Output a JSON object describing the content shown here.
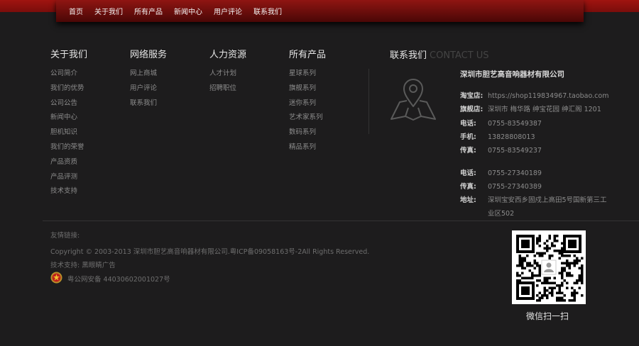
{
  "nav": [
    "首页",
    "关于我们",
    "所有产品",
    "新闻中心",
    "用户评论",
    "联系我们"
  ],
  "columns": [
    {
      "title": "关于我们",
      "items": [
        "公司简介",
        "我们的优势",
        "公司公告",
        "新闻中心",
        "胆机知识",
        "我们的荣誉",
        "产品资质",
        "产品评测",
        "技术支持"
      ]
    },
    {
      "title": "网络服务",
      "items": [
        "网上商城",
        "用户评论",
        "联系我们"
      ]
    },
    {
      "title": "人力资源",
      "items": [
        "人才计划",
        "招聘职位"
      ]
    },
    {
      "title": "所有产品",
      "items": [
        "星球系列",
        "旗舰系列",
        "迷你系列",
        "艺术家系列",
        "数码系列",
        "精品系列"
      ]
    }
  ],
  "contact": {
    "title": "联系我们",
    "title_en": "CONTACT US",
    "company": "深圳市胆艺高音响器材有限公司",
    "rows": [
      {
        "k": "淘宝店:",
        "v": "https://shop119834967.taobao.com"
      },
      {
        "k": "旗舰店:",
        "v": "深圳市 梅华路 绅宝花园 绅汇阁 1201"
      },
      {
        "k": "电话:",
        "v": "0755-83549387"
      },
      {
        "k": "手机:",
        "v": "13828808013"
      },
      {
        "k": "传真:",
        "v": "0755-83549237"
      },
      {
        "k": "电话:",
        "v": "0755-27340189"
      },
      {
        "k": "传真:",
        "v": "0755-27340389"
      },
      {
        "k": "地址:",
        "v": "深圳宝安西乡固戍上高田5号国新第三工"
      },
      {
        "k": "",
        "v": "业区502"
      }
    ]
  },
  "footer": {
    "links_label": "友情链接:",
    "copyright": "Copyright © 2003-2013 深圳市胆艺高音响器材有限公司.粤ICP备09058163号-2All Rights Reserved.",
    "tech": "技术支持: 黑眼睛广告",
    "police": "粤公网安备 44030602001027号"
  },
  "qr_label": "微信扫一扫"
}
